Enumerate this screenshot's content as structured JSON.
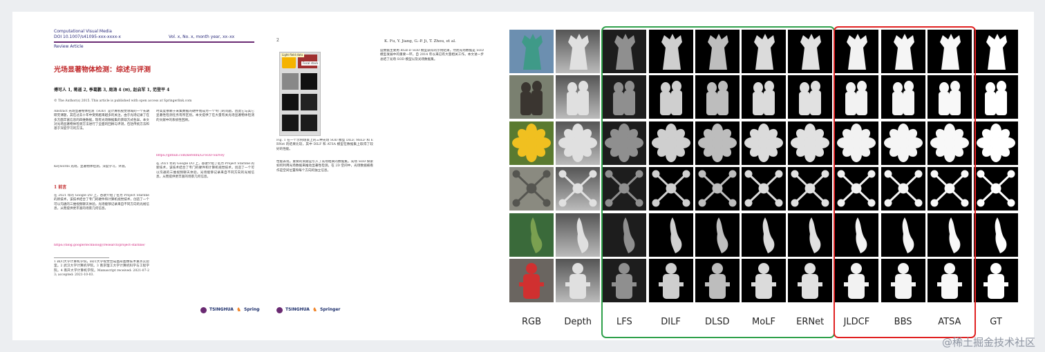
{
  "paper": {
    "journal": "Computational Visual Media",
    "doi": "DOI 10.1007/s41095-xxx-xxxx-x",
    "volume": "Vol. x, No. x, month year, xx–xx",
    "article_type": "Review Article",
    "title": "光场显著物体检测：综述与评测",
    "authors": "傅可人 1, 蒋遥 2, 季葛鹏 3, 周涛 4 (✉), 赵启军 1, 范登平 4",
    "copyright": "© The Author(s) 2015. This article is published with open access at Springerlink.com",
    "abstract_text": "Abstract 光场显著物体检测（SOD）是计算机视觉领域的一个长期研究课题，其在过去十年中受到越来越多的关注。由于光场记录了在多方面丰富信息的四维数据，现有光场数据集的获取方式各异。本文对光场显著物体检测方法进行了全面的回顾与评测，包括传统方法和基于深度学习的方法。",
    "keywords": "Keywords 光场，显著物体检测，深度学习，评测。",
    "section1": "1 前言",
    "body_col1": "在 2021 年的 Google I/O 上，谷歌介绍了名为 Project Starline 的新技术，该技术结合了专门的硬件和计算机视觉技术，创造了一个可以沟通的三维视频聊天体验。光场能够记录来自不同方向的光线信息，从而提供更丰富的场景几何信息。",
    "body_col2": "时高度依赖于采集数据的硬件而成为一个专门的问题。因此它与其它显著性检测任务有所区别。本文提供了在大量有关光场显著物体检测的文献中的系统性回顾。",
    "url1": "https://blog.google/technology/research/project-starline/",
    "url2": "https://github.com/kerenfu/LFSOD-Survey",
    "footnotes": "1 四川大学计算机学院，四川大学视觉合成图形图像技术重点实验室。2 武汉大学计算机学院。3 南京理工大学计算机科学与工程学院。4 南开大学计算机学院。Manuscript received: 2021-07-23; accepted: 2021-10-03.",
    "page2_header": "K. Fu, Y. Jiang, G.-P. Ji, T. Zhou, et al.",
    "page2_num": "2",
    "fig1_label": "Light field data",
    "fig1_sublabel": "Focal stack",
    "fig1_caption": "Fig. 1 在一个示例场景上的三种光场 SOD 模型 DILF, MoLF 和 ERNet 的结果比较，其中 DILF 和 ATSA 模型在数据集上取得了较好的性能。",
    "page2_col1": "性能表现。重要的贡献是引入了光场相关的数据集。光场 SOD 探索如何利用光场数据来推动显著性检测。在 2D 空间中，光场数据被看作是空间位置和每个方向的独立信息。",
    "page2_col2": "度数据主要用 RGB-D SOD 模型获得的示例结果。然而光场数据是 SOD 模型发展中的重要一环。自 2014 年以来已有大量相关工作。本文进一步总结了光场 SOD 模型以及光场数据集。",
    "publisher": "Springer",
    "univ": "TSINGHUA"
  },
  "comparison": {
    "columns": [
      {
        "key": "rgb",
        "label": "RGB"
      },
      {
        "key": "depth",
        "label": "Depth"
      },
      {
        "key": "lfs",
        "label": "LFS"
      },
      {
        "key": "dilf",
        "label": "DILF"
      },
      {
        "key": "dlsd",
        "label": "DLSD"
      },
      {
        "key": "molf",
        "label": "MoLF"
      },
      {
        "key": "ernet",
        "label": "ERNet"
      },
      {
        "key": "jldcf",
        "label": "JLDCF"
      },
      {
        "key": "bbs",
        "label": "BBS"
      },
      {
        "key": "atsa",
        "label": "ATSA"
      },
      {
        "key": "gt",
        "label": "GT"
      }
    ],
    "rows": [
      "statue",
      "couple",
      "flower",
      "drone",
      "leaves",
      "person"
    ],
    "group_green": [
      "LFS",
      "DILF",
      "DLSD",
      "MoLF",
      "ERNet"
    ],
    "group_red": [
      "JLDCF",
      "BBS",
      "ATSA"
    ],
    "colors": {
      "green": "#2ea04a",
      "red": "#e02020"
    }
  },
  "watermark": "@稀土掘金技术社区"
}
